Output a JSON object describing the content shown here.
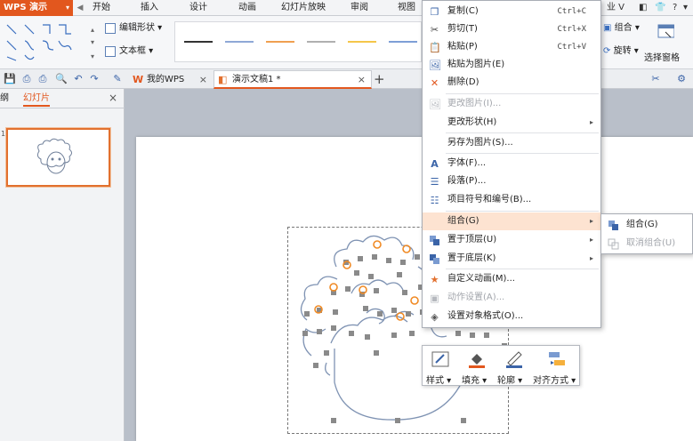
{
  "app": {
    "title": "WPS 演示"
  },
  "menu_tabs": [
    "开始",
    "插入",
    "设计",
    "动画",
    "幻灯片放映",
    "审阅",
    "视图"
  ],
  "menu_right": {
    "label": "业 V"
  },
  "ribbon": {
    "edit_shape": "编辑形状",
    "text_box": "文本框",
    "group": "组合",
    "rotate": "旋转",
    "selection_pane": "选择窗格"
  },
  "doc_tabs": [
    {
      "label": "我的WPS",
      "close": "×"
    },
    {
      "label": "演示文稿1 *",
      "close": "×"
    }
  ],
  "new_tab": "+",
  "left_panel": {
    "tab_outline": "纲",
    "tab_slides": "幻灯片",
    "close": "×",
    "slide_number": "1"
  },
  "context_menu": {
    "items": [
      {
        "label": "复制(C)",
        "shortcut": "Ctrl+C",
        "icon": "copy-icon"
      },
      {
        "label": "剪切(T)",
        "shortcut": "Ctrl+X",
        "icon": "cut-icon"
      },
      {
        "label": "粘贴(P)",
        "shortcut": "Ctrl+V",
        "icon": "paste-icon"
      },
      {
        "label": "粘贴为图片(E)",
        "icon": "paste-picture-icon"
      },
      {
        "label": "删除(D)",
        "icon": "delete-icon"
      },
      {
        "label": "更改图片(I)...",
        "icon": "change-picture-icon"
      },
      {
        "label": "更改形状(H)",
        "icon": "change-shape-icon"
      },
      {
        "label": "另存为图片(S)...",
        "icon": "save-as-picture-icon"
      },
      {
        "label": "字体(F)...",
        "icon": "font-icon"
      },
      {
        "label": "段落(P)...",
        "icon": "paragraph-icon"
      },
      {
        "label": "项目符号和编号(B)...",
        "icon": "bullets-icon"
      },
      {
        "label": "组合(G)",
        "icon": "group-icon"
      },
      {
        "label": "置于顶层(U)",
        "icon": "bring-to-front-icon"
      },
      {
        "label": "置于底层(K)",
        "icon": "send-to-back-icon"
      },
      {
        "label": "自定义动画(M)...",
        "icon": "custom-animation-icon"
      },
      {
        "label": "动作设置(A)...",
        "icon": "action-settings-icon"
      },
      {
        "label": "设置对象格式(O)...",
        "icon": "format-object-icon"
      }
    ]
  },
  "submenu": {
    "group": "组合(G)",
    "ungroup": "取消组合(U)"
  },
  "mini_toolbar": {
    "style": "样式",
    "fill": "填充",
    "outline": "轮廓",
    "align": "对齐方式"
  },
  "colors": {
    "accent": "#e2571e",
    "highlight": "#fde3d1",
    "handle": "#8a8a8a",
    "rotate_handle": "#f08a24",
    "curve": "#7f93b3"
  }
}
